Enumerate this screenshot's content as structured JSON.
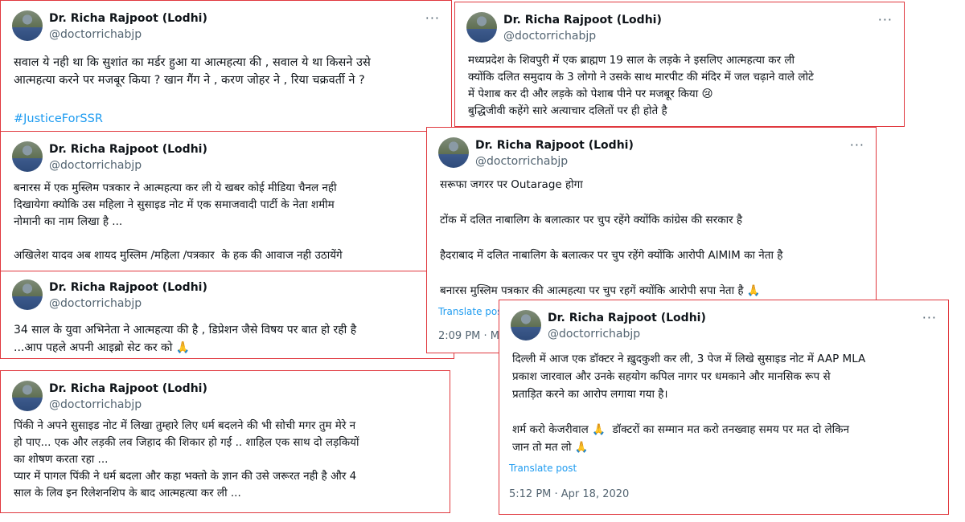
{
  "tweets": [
    {
      "name": "Dr. Richa Rajpoot (Lodhi)",
      "handle": "@doctorrichabjp",
      "more": "···",
      "text": "सवाल ये नही था कि सुशांत का मर्डर हुआ या आत्महत्या की , सवाल ये था किसने उसे\nआत्महत्या करने पर मजबूर किया ? खान गैंग ने , करण जोहर ने , रिया चक्रवर्ती ने ?",
      "hashtag": "#JusticeForSSR"
    },
    {
      "name": "Dr. Richa Rajpoot (Lodhi)",
      "handle": "@doctorrichabjp",
      "more": "···",
      "text": "मध्यप्रदेश के शिवपुरी में एक ब्राह्मण 19 साल के लड़के ने इसलिए आत्महत्या कर ली\nक्योंकि दलित समुदाय के 3 लोगो ने उसके साथ मारपीट की मंदिर में जल चढ़ाने वाले लोटे\nमें पेशाब कर दी और लड़के को पेशाब पीने पर मजबूर किया 😢\nबुद्धिजीवी कहेंगे सारे अत्याचार दलितों पर ही होते है"
    },
    {
      "name": "Dr. Richa Rajpoot (Lodhi)",
      "handle": "@doctorrichabjp",
      "text": "बनारस में एक मुस्लिम पत्रकार ने आत्महत्या कर ली ये खबर कोई मीडिया चैनल नही\nदिखायेगा क्योकि उस महिला ने सुसाइड नोट में एक समाजवादी पार्टी के नेता शमीम\nनोमानी का नाम लिखा है ...\n\nअखिलेश यादव अब शायद मुस्लिम /महिला /पत्रकार  के हक की आवाज नही उठायेंगे"
    },
    {
      "name": "Dr. Richa Rajpoot (Lodhi)",
      "handle": "@doctorrichabjp",
      "more": "···",
      "text": "सरूफा जगरर पर Outarage होगा\n\nटोंक में दलित नाबालिग के बलात्कार पर चुप रहेंगे क्योंकि कांग्रेस की सरकार है\n\nहैदराबाद में दलित नाबालिग के बलात्कर पर चुप रहेंगे क्योंकि आरोपी AIMIM का नेता है\n\nबनारस मुस्लिम पत्रकार की आत्महत्या पर चुप रहगें क्योंकि आरोपी सपा नेता है 🙏",
      "translate": "Translate post",
      "time": "2:09 PM · M"
    },
    {
      "name": "Dr. Richa Rajpoot (Lodhi)",
      "handle": "@doctorrichabjp",
      "text": "34 साल के युवा अभिनेता ने आत्महत्या की है , डिप्रेशन जैसे विषय पर बात हो रही है\n...आप पहले अपनी आइब्रो सेट कर को 🙏"
    },
    {
      "name": "Dr. Richa Rajpoot (Lodhi)",
      "handle": "@doctorrichabjp",
      "more": "···",
      "text": "दिल्ली में आज एक डॉक्टर ने ख़ुदकुशी कर ली, 3 पेज में लिखे सुसाइड नोट में AAP MLA\nप्रकाश जारवाल और उनके सहयोग कपिल नागर पर धमकाने और मानसिक रूप से\nप्रताड़ित करने का आरोप लगाया गया है।\n\nशर्म करो केजरीवाल 🙏  डॉक्टरों का सम्मान मत करो तनख्वाह समय पर मत दो लेकिन\nजान तो मत लो 🙏",
      "translate": "Translate post",
      "time": "5:12 PM · Apr 18, 2020"
    },
    {
      "name": "Dr. Richa Rajpoot (Lodhi)",
      "handle": "@doctorrichabjp",
      "text": "पिंकी ने अपने सुसाइड नोट में लिखा तुम्हारे लिए धर्म बदलने की भी सोची मगर तुम मेरे न\nहो पाए... एक और लड़की लव जिहाद की शिकार हो गई .. शाहिल एक साथ दो लड़कियों\nका शोषण करता रहा ...\nप्यार में पागल पिंकी ने धर्म बदला और कहा भक्तो के ज्ञान की उसे जरूरत नही है और 4\nसाल के लिव इन रिलेशनशिप के बाद आत्महत्या कर ली ..."
    }
  ]
}
